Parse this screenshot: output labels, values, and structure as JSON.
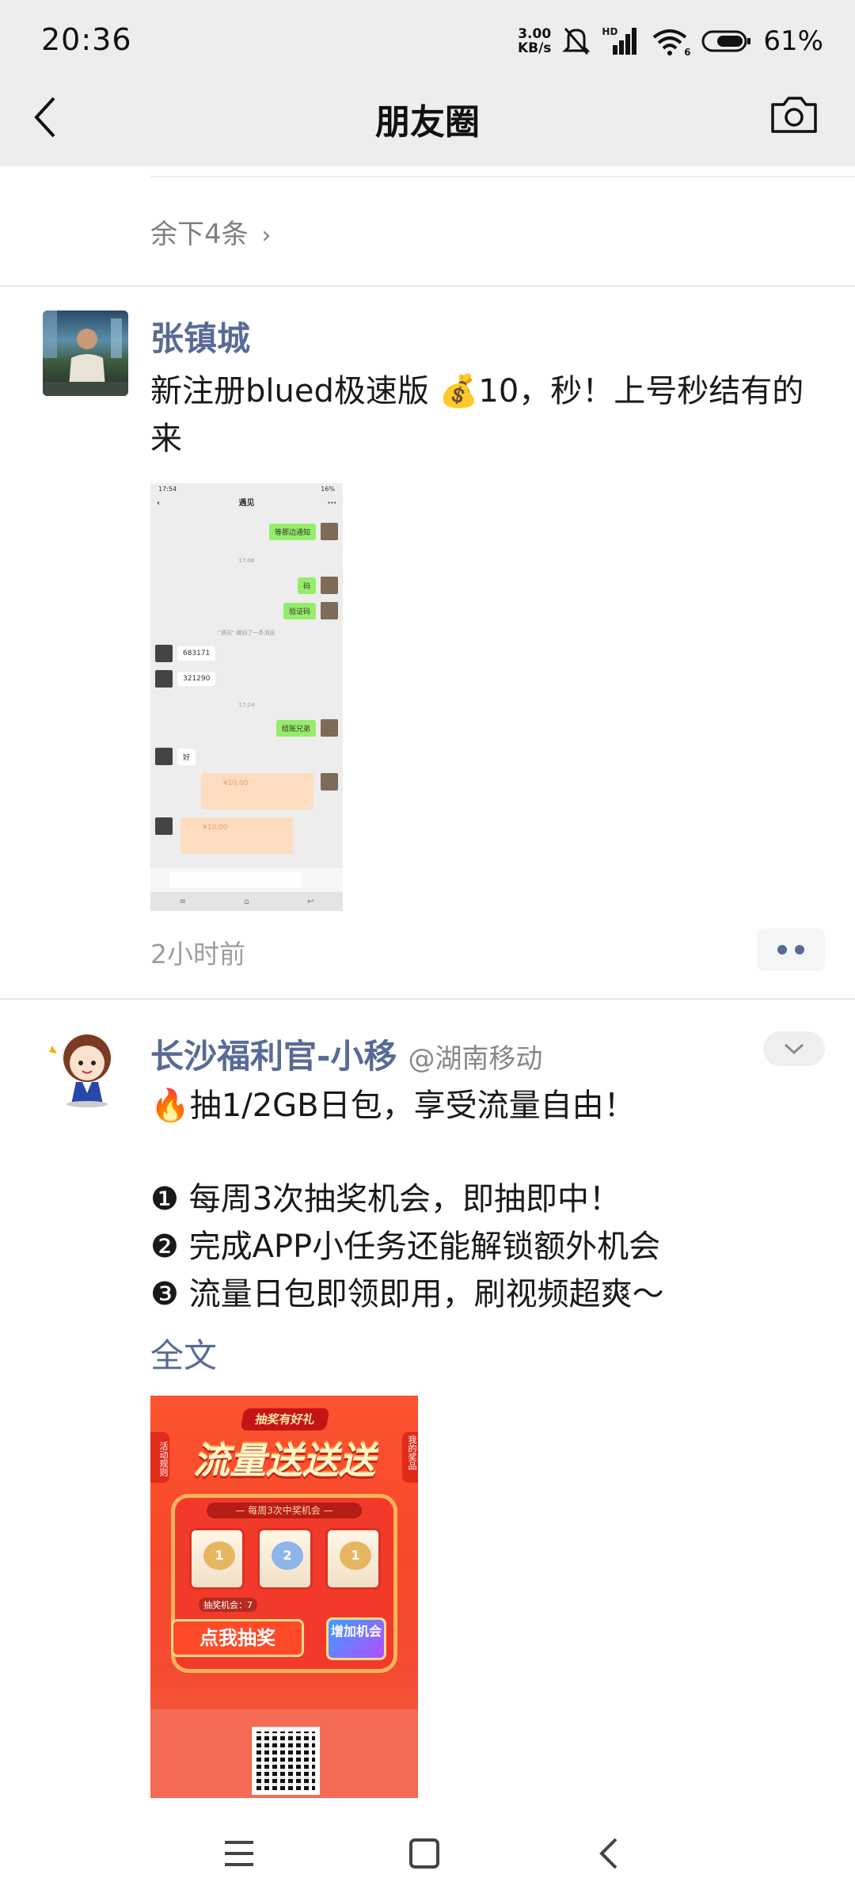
{
  "status_bar": {
    "time": "20:36",
    "net_speed_value": "3.00",
    "net_speed_unit": "KB/s",
    "signal_label": "HD",
    "wifi_label": "6",
    "battery": "61%"
  },
  "nav": {
    "title": "朋友圈",
    "back_icon": "back-arrow-icon",
    "camera_icon": "camera-icon"
  },
  "collapsed_comments": {
    "label": "余下4条"
  },
  "posts": [
    {
      "author": "张镇城",
      "text": "新注册blued极速版 💰10，秒！上号秒结有的来",
      "time": "2小时前",
      "screenshot": {
        "status_time": "17:54",
        "status_battery": "16%",
        "title": "遇见",
        "messages": [
          {
            "side": "right",
            "text": "等那边通知"
          },
          {
            "side": "time",
            "text": "17:06"
          },
          {
            "side": "right",
            "text": "码"
          },
          {
            "side": "right",
            "text": "验证码"
          },
          {
            "side": "note",
            "text": "\"遇见\" 撤回了一条消息"
          },
          {
            "side": "left",
            "text": "683171"
          },
          {
            "side": "left",
            "text": "321290"
          },
          {
            "side": "time",
            "text": "17:24"
          },
          {
            "side": "right",
            "text": "结账兄弟"
          },
          {
            "side": "left",
            "text": "好"
          },
          {
            "side": "right",
            "text": "¥10.00"
          },
          {
            "side": "left",
            "text": "¥10.00"
          }
        ]
      }
    },
    {
      "author": "长沙福利官-小移",
      "handle": "@湖南移动",
      "line1": "🔥抽1/2GB日包，享受流量自由！",
      "line2": "❶ 每周3次抽奖机会，即抽即中！",
      "line3": "❷ 完成APP小任务还能解锁额外机会",
      "line4": "❸ 流量日包即领即用，刷视频超爽～",
      "full_text_link": "全文",
      "promo": {
        "badge": "抽奖有好礼",
        "headline": "流量送送送",
        "side_left": "活动规则",
        "side_right": "我的奖品",
        "machine_label": "— 每周3次中奖机会 —",
        "reel_values": [
          "1",
          "2",
          "1"
        ],
        "chances": "抽奖机会：7",
        "draw_button": "点我抽奖",
        "add_button": "增加机会"
      }
    }
  ],
  "system_nav": {
    "menu_icon": "menu-icon",
    "home_icon": "home-square-icon",
    "back_icon": "back-triangle-icon"
  },
  "colors": {
    "link": "#576b95",
    "bar_bg": "#ededed",
    "secondary_text": "#9e9e9e"
  }
}
